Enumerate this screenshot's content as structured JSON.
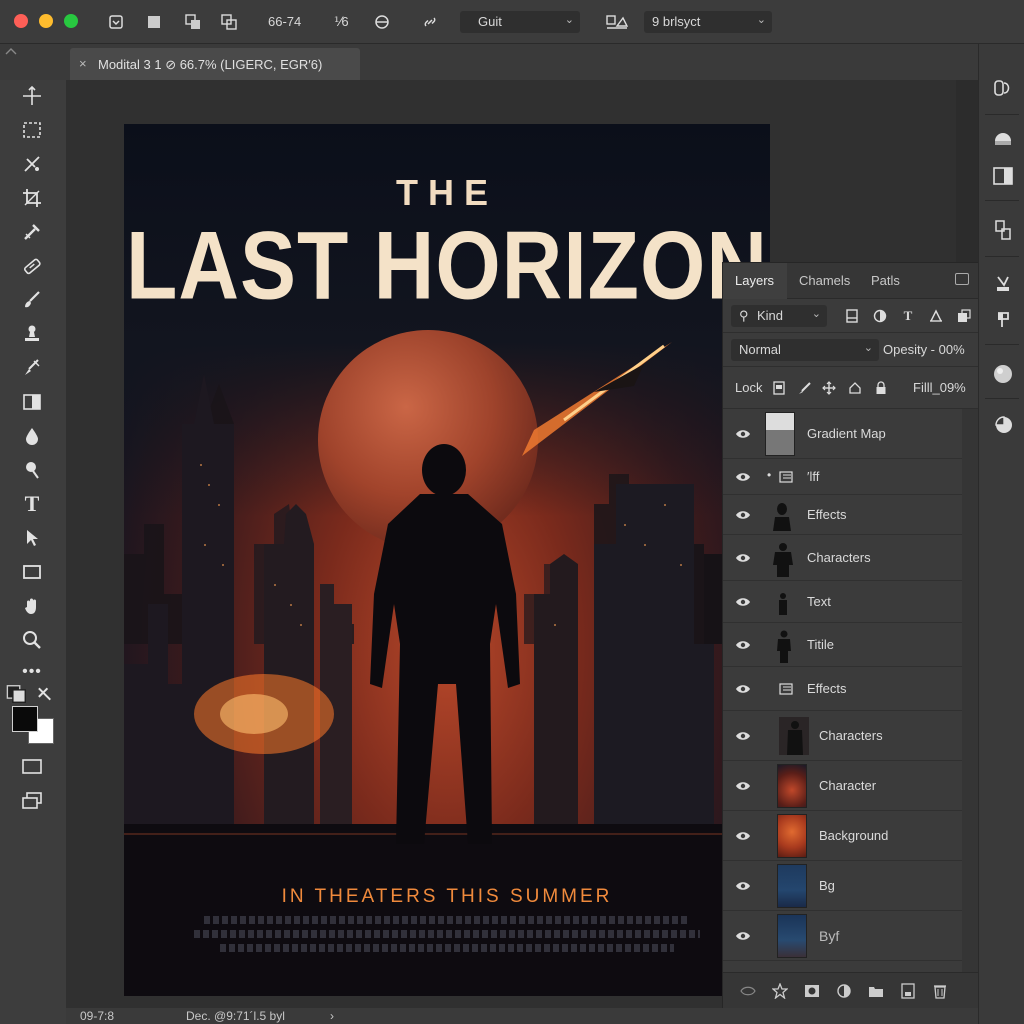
{
  "options_bar": {
    "zoom_values": "66-74",
    "ratio": "⅟6",
    "preset_dropdown": "Guit",
    "style_dropdown": "9 brlsyct"
  },
  "document_tab": {
    "title": "Modital 3 1 ⊘ 66.7% (LIGERC, EGR′6)"
  },
  "poster": {
    "title_top": "THE",
    "title_main": "LAST HORIZON",
    "tagline": "IN THEATERS THIS SUMMER"
  },
  "layers_panel": {
    "tabs": [
      "Layers",
      "Chamels",
      "Patls"
    ],
    "kind_label": "Kind",
    "blend_mode": "Normal",
    "opacity_label": "Opesity - 00%",
    "lock_label": "Lock",
    "fill_label": "Filll_09%",
    "layers": [
      {
        "name": "Gradient Map"
      },
      {
        "name": "′lff"
      },
      {
        "name": "Effects"
      },
      {
        "name": "Characters"
      },
      {
        "name": "Text"
      },
      {
        "name": "Titile"
      },
      {
        "name": "Effects"
      },
      {
        "name": "Characters"
      },
      {
        "name": "Character"
      },
      {
        "name": "Background"
      },
      {
        "name": "Bg"
      },
      {
        "name": "Byf"
      }
    ]
  },
  "status_bar": {
    "zoom": "09-7:8",
    "doc_info": "Dec. @9:71´l.5 byl"
  },
  "colors": {
    "close": "#fe5f57",
    "minimize": "#febc2e",
    "maximize": "#28c840",
    "tagline": "#f08a3c",
    "title": "#f4e2c8"
  }
}
